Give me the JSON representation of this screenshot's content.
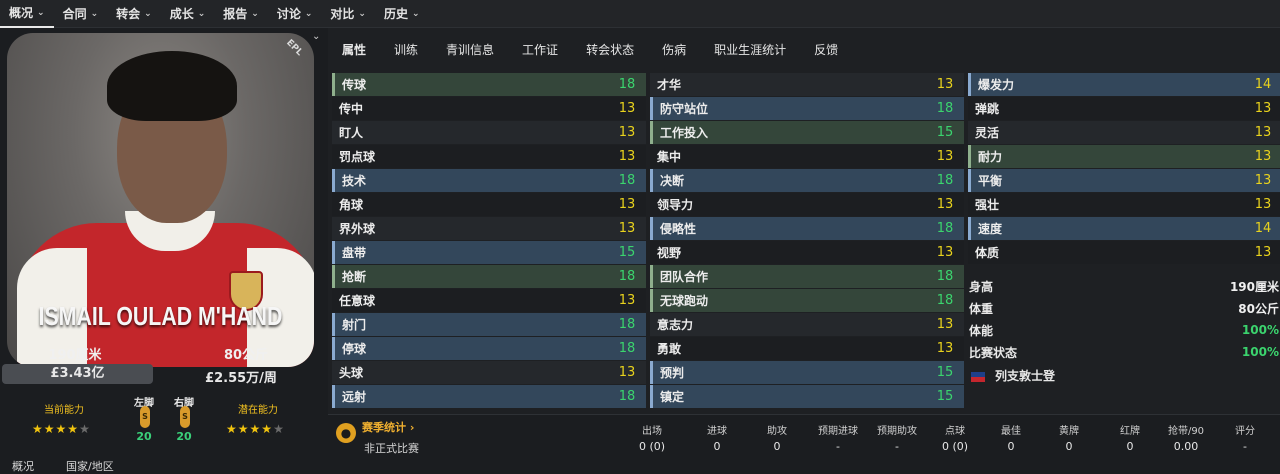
{
  "topnav": [
    {
      "label": "概况",
      "active": true
    },
    {
      "label": "合同"
    },
    {
      "label": "转会"
    },
    {
      "label": "成长"
    },
    {
      "label": "报告"
    },
    {
      "label": "讨论"
    },
    {
      "label": "对比"
    },
    {
      "label": "历史"
    }
  ],
  "card": {
    "name": "ISMAIL OULAD M'HAND",
    "league": "EPL"
  },
  "player": {
    "height": "190厘米",
    "weight": "80公斤",
    "value": "£3.43亿",
    "wage": "£2.55万/周",
    "current_ability_label": "当前能力",
    "potential_ability_label": "潜在能力",
    "left_foot_label": "左脚",
    "right_foot_label": "右脚",
    "left_foot_value": "20",
    "right_foot_value": "20",
    "current_stars": 4,
    "potential_stars": 4
  },
  "bottom_tabs": [
    "概况",
    "国家/地区"
  ],
  "subtabs": [
    "属性",
    "训练",
    "青训信息",
    "工作证",
    "转会状态",
    "伤病",
    "职业生涯统计",
    "反馈"
  ],
  "attributes": {
    "technical": [
      {
        "name": "传球",
        "value": "18",
        "hl": "g"
      },
      {
        "name": "传中",
        "value": "13"
      },
      {
        "name": "盯人",
        "value": "13"
      },
      {
        "name": "罚点球",
        "value": "13"
      },
      {
        "name": "技术",
        "value": "18",
        "hl": "b"
      },
      {
        "name": "角球",
        "value": "13"
      },
      {
        "name": "界外球",
        "value": "13"
      },
      {
        "name": "盘带",
        "value": "15",
        "hl": "b"
      },
      {
        "name": "抢断",
        "value": "18",
        "hl": "g"
      },
      {
        "name": "任意球",
        "value": "13"
      },
      {
        "name": "射门",
        "value": "18",
        "hl": "b"
      },
      {
        "name": "停球",
        "value": "18",
        "hl": "b"
      },
      {
        "name": "头球",
        "value": "13"
      },
      {
        "name": "远射",
        "value": "18",
        "hl": "b"
      }
    ],
    "mental": [
      {
        "name": "才华",
        "value": "13"
      },
      {
        "name": "防守站位",
        "value": "18",
        "hl": "b"
      },
      {
        "name": "工作投入",
        "value": "15",
        "hl": "g"
      },
      {
        "name": "集中",
        "value": "13"
      },
      {
        "name": "决断",
        "value": "18",
        "hl": "b"
      },
      {
        "name": "领导力",
        "value": "13"
      },
      {
        "name": "侵略性",
        "value": "18",
        "hl": "b"
      },
      {
        "name": "视野",
        "value": "13"
      },
      {
        "name": "团队合作",
        "value": "18",
        "hl": "g"
      },
      {
        "name": "无球跑动",
        "value": "18",
        "hl": "g"
      },
      {
        "name": "意志力",
        "value": "13"
      },
      {
        "name": "勇敢",
        "value": "13"
      },
      {
        "name": "预判",
        "value": "15",
        "hl": "b"
      },
      {
        "name": "镇定",
        "value": "15",
        "hl": "b"
      }
    ],
    "physical": [
      {
        "name": "爆发力",
        "value": "14",
        "hl": "b"
      },
      {
        "name": "弹跳",
        "value": "13"
      },
      {
        "name": "灵活",
        "value": "13"
      },
      {
        "name": "耐力",
        "value": "13",
        "hl": "g"
      },
      {
        "name": "平衡",
        "value": "13",
        "hl": "b"
      },
      {
        "name": "强壮",
        "value": "13"
      },
      {
        "name": "速度",
        "value": "14",
        "hl": "b"
      },
      {
        "name": "体质",
        "value": "13"
      }
    ]
  },
  "info": [
    {
      "label": "身高",
      "value": "190厘米"
    },
    {
      "label": "体重",
      "value": "80公斤"
    },
    {
      "label": "体能",
      "value": "100%",
      "green": true
    },
    {
      "label": "比赛状态",
      "value": "100%",
      "green": true
    }
  ],
  "nation": "列支敦士登",
  "stats": {
    "link": "赛季统计",
    "headers": [
      "出场",
      "进球",
      "助攻",
      "预期进球",
      "预期助攻",
      "点球",
      "最佳",
      "黄牌",
      "红牌",
      "抢带/90",
      "评分"
    ],
    "row_label": "非正式比赛",
    "values": [
      "0 (0)",
      "0",
      "0",
      "-",
      "-",
      "0 (0)",
      "0",
      "0",
      "0",
      "0.00",
      "-"
    ]
  }
}
